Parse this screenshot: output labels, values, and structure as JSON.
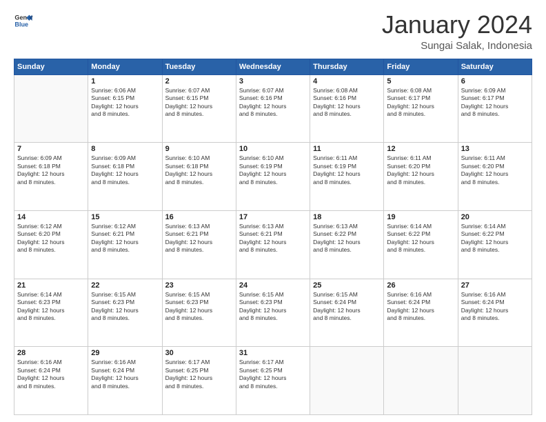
{
  "logo": {
    "line1": "General",
    "line2": "Blue"
  },
  "header": {
    "month": "January 2024",
    "location": "Sungai Salak, Indonesia"
  },
  "weekdays": [
    "Sunday",
    "Monday",
    "Tuesday",
    "Wednesday",
    "Thursday",
    "Friday",
    "Saturday"
  ],
  "weeks": [
    [
      {
        "day": "",
        "info": ""
      },
      {
        "day": "1",
        "info": "Sunrise: 6:06 AM\nSunset: 6:15 PM\nDaylight: 12 hours\nand 8 minutes."
      },
      {
        "day": "2",
        "info": "Sunrise: 6:07 AM\nSunset: 6:15 PM\nDaylight: 12 hours\nand 8 minutes."
      },
      {
        "day": "3",
        "info": "Sunrise: 6:07 AM\nSunset: 6:16 PM\nDaylight: 12 hours\nand 8 minutes."
      },
      {
        "day": "4",
        "info": "Sunrise: 6:08 AM\nSunset: 6:16 PM\nDaylight: 12 hours\nand 8 minutes."
      },
      {
        "day": "5",
        "info": "Sunrise: 6:08 AM\nSunset: 6:17 PM\nDaylight: 12 hours\nand 8 minutes."
      },
      {
        "day": "6",
        "info": "Sunrise: 6:09 AM\nSunset: 6:17 PM\nDaylight: 12 hours\nand 8 minutes."
      }
    ],
    [
      {
        "day": "7",
        "info": "Sunrise: 6:09 AM\nSunset: 6:18 PM\nDaylight: 12 hours\nand 8 minutes."
      },
      {
        "day": "8",
        "info": "Sunrise: 6:09 AM\nSunset: 6:18 PM\nDaylight: 12 hours\nand 8 minutes."
      },
      {
        "day": "9",
        "info": "Sunrise: 6:10 AM\nSunset: 6:18 PM\nDaylight: 12 hours\nand 8 minutes."
      },
      {
        "day": "10",
        "info": "Sunrise: 6:10 AM\nSunset: 6:19 PM\nDaylight: 12 hours\nand 8 minutes."
      },
      {
        "day": "11",
        "info": "Sunrise: 6:11 AM\nSunset: 6:19 PM\nDaylight: 12 hours\nand 8 minutes."
      },
      {
        "day": "12",
        "info": "Sunrise: 6:11 AM\nSunset: 6:20 PM\nDaylight: 12 hours\nand 8 minutes."
      },
      {
        "day": "13",
        "info": "Sunrise: 6:11 AM\nSunset: 6:20 PM\nDaylight: 12 hours\nand 8 minutes."
      }
    ],
    [
      {
        "day": "14",
        "info": "Sunrise: 6:12 AM\nSunset: 6:20 PM\nDaylight: 12 hours\nand 8 minutes."
      },
      {
        "day": "15",
        "info": "Sunrise: 6:12 AM\nSunset: 6:21 PM\nDaylight: 12 hours\nand 8 minutes."
      },
      {
        "day": "16",
        "info": "Sunrise: 6:13 AM\nSunset: 6:21 PM\nDaylight: 12 hours\nand 8 minutes."
      },
      {
        "day": "17",
        "info": "Sunrise: 6:13 AM\nSunset: 6:21 PM\nDaylight: 12 hours\nand 8 minutes."
      },
      {
        "day": "18",
        "info": "Sunrise: 6:13 AM\nSunset: 6:22 PM\nDaylight: 12 hours\nand 8 minutes."
      },
      {
        "day": "19",
        "info": "Sunrise: 6:14 AM\nSunset: 6:22 PM\nDaylight: 12 hours\nand 8 minutes."
      },
      {
        "day": "20",
        "info": "Sunrise: 6:14 AM\nSunset: 6:22 PM\nDaylight: 12 hours\nand 8 minutes."
      }
    ],
    [
      {
        "day": "21",
        "info": "Sunrise: 6:14 AM\nSunset: 6:23 PM\nDaylight: 12 hours\nand 8 minutes."
      },
      {
        "day": "22",
        "info": "Sunrise: 6:15 AM\nSunset: 6:23 PM\nDaylight: 12 hours\nand 8 minutes."
      },
      {
        "day": "23",
        "info": "Sunrise: 6:15 AM\nSunset: 6:23 PM\nDaylight: 12 hours\nand 8 minutes."
      },
      {
        "day": "24",
        "info": "Sunrise: 6:15 AM\nSunset: 6:23 PM\nDaylight: 12 hours\nand 8 minutes."
      },
      {
        "day": "25",
        "info": "Sunrise: 6:15 AM\nSunset: 6:24 PM\nDaylight: 12 hours\nand 8 minutes."
      },
      {
        "day": "26",
        "info": "Sunrise: 6:16 AM\nSunset: 6:24 PM\nDaylight: 12 hours\nand 8 minutes."
      },
      {
        "day": "27",
        "info": "Sunrise: 6:16 AM\nSunset: 6:24 PM\nDaylight: 12 hours\nand 8 minutes."
      }
    ],
    [
      {
        "day": "28",
        "info": "Sunrise: 6:16 AM\nSunset: 6:24 PM\nDaylight: 12 hours\nand 8 minutes."
      },
      {
        "day": "29",
        "info": "Sunrise: 6:16 AM\nSunset: 6:24 PM\nDaylight: 12 hours\nand 8 minutes."
      },
      {
        "day": "30",
        "info": "Sunrise: 6:17 AM\nSunset: 6:25 PM\nDaylight: 12 hours\nand 8 minutes."
      },
      {
        "day": "31",
        "info": "Sunrise: 6:17 AM\nSunset: 6:25 PM\nDaylight: 12 hours\nand 8 minutes."
      },
      {
        "day": "",
        "info": ""
      },
      {
        "day": "",
        "info": ""
      },
      {
        "day": "",
        "info": ""
      }
    ]
  ]
}
